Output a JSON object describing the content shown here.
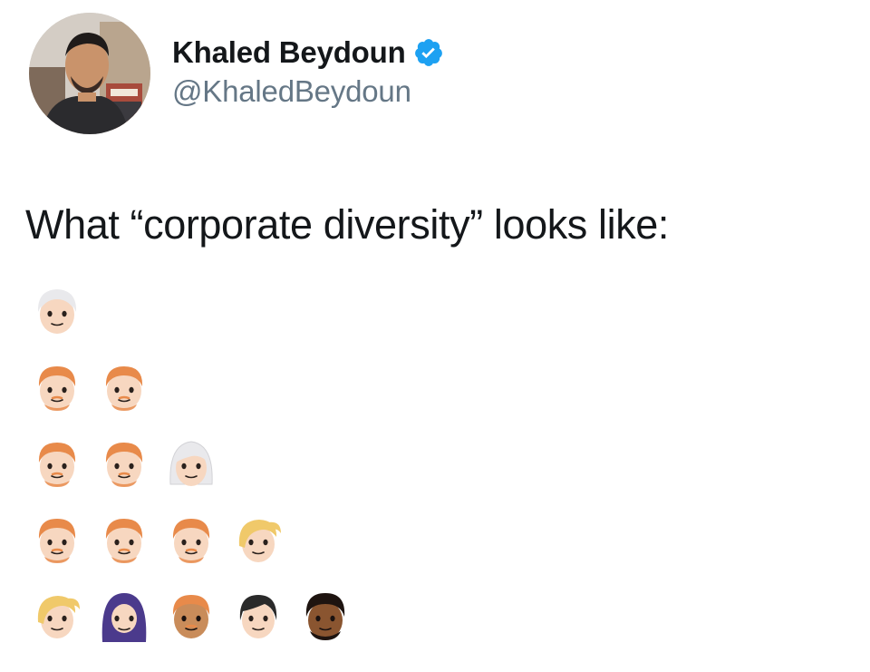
{
  "author": {
    "display_name": "Khaled Beydoun",
    "handle": "@KhaledBeydoun",
    "verified": true,
    "avatar_icon": "profile-photo"
  },
  "tweet": {
    "text": "What “corporate diversity” looks like:"
  },
  "emoji_rows": [
    [
      "older-man"
    ],
    [
      "man-red-hair",
      "man-red-hair"
    ],
    [
      "man-red-hair",
      "man-red-hair",
      "old-woman"
    ],
    [
      "man-red-hair",
      "man-red-hair",
      "man-red-hair",
      "woman-blonde"
    ],
    [
      "woman-blonde",
      "woman-headscarf",
      "man-medium-skin",
      "woman-black-hair",
      "man-dark-skin"
    ]
  ],
  "colors": {
    "text": "#14171a",
    "secondary_text": "#657786",
    "verified_blue": "#1da1f2",
    "skin_light": "#f7d7c0",
    "skin_medium": "#c98c5a",
    "skin_dark": "#8a5530",
    "hair_red": "#e88a4a",
    "hair_white": "#e9e9ec",
    "hair_blonde": "#f0c96a",
    "hair_black": "#2a2a2a",
    "headscarf_purple": "#4b3a8c"
  }
}
